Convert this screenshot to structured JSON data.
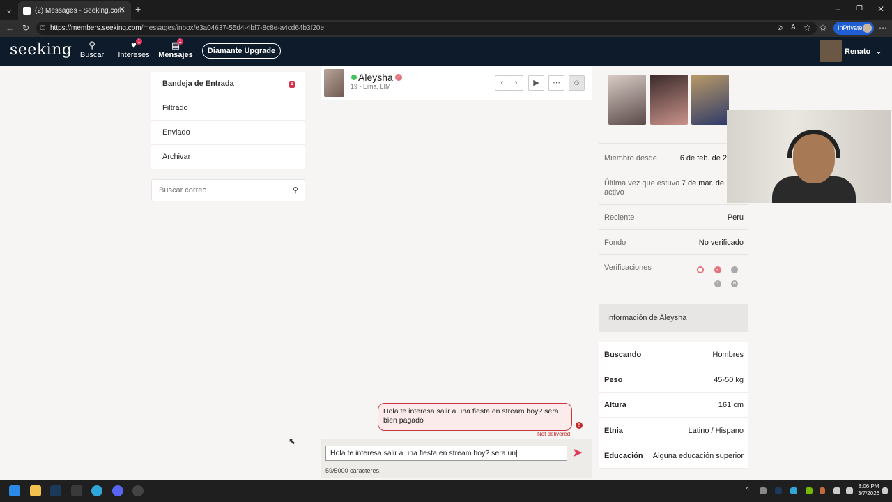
{
  "browser": {
    "tab_title": "(2) Messages - Seeking.com",
    "url_domain": "https://members.seeking.com",
    "url_path": "/messages/inbox/e3a04637-55d4-4bf7-8c8e-a4cd64b3f20e",
    "inprivate_label": "InPrivate"
  },
  "site": {
    "logo": "seeking",
    "nav": {
      "search_label": "Buscar",
      "interests_label": "Intereses",
      "interests_badge": "1",
      "messages_label": "Mensajes",
      "messages_badge": "1"
    },
    "upgrade_label": "Diamante Upgrade",
    "username": "Renato"
  },
  "inbox_menu": {
    "items": [
      {
        "label": "Bandeja de Entrada",
        "badge": "1"
      },
      {
        "label": "Filtrado"
      },
      {
        "label": "Enviado"
      },
      {
        "label": "Archivar"
      }
    ],
    "search_placeholder": "Buscar correo"
  },
  "chat": {
    "name": "Aleysha",
    "subtitle": "19 - Lima, LIM",
    "message": "Hola te interesa salir a una fiesta en stream hoy? sera bien pagado",
    "status": "Not delivered",
    "input_value": "Hola te interesa salir a una fiesta en stream hoy? sera un",
    "char_count": "59/5000 caracteres."
  },
  "profile": {
    "rows": [
      {
        "label": "Miembro desde",
        "value": "6 de feb. de 2"
      },
      {
        "label": "Última vez que estuvo activo",
        "value": "7 de mar. de"
      },
      {
        "label": "Reciente",
        "value": "Peru"
      },
      {
        "label": "Fondo",
        "value": "No verificado"
      },
      {
        "label": "Verificaciones",
        "value": ""
      }
    ],
    "info_heading": "Información de Aleysha",
    "details": [
      {
        "label": "Buscando",
        "value": "Hombres"
      },
      {
        "label": "Peso",
        "value": "45-50 kg"
      },
      {
        "label": "Altura",
        "value": "161 cm"
      },
      {
        "label": "Etnia",
        "value": "Latino / Hispano"
      },
      {
        "label": "Educación",
        "value": "Alguna educación superior"
      }
    ]
  },
  "taskbar": {
    "time": "8:06 PM",
    "date": "3/7/2026"
  },
  "colors": {
    "header_bg": "#0d1b2a",
    "accent": "#e0395a",
    "error": "#c62828",
    "online": "#43c35e"
  }
}
